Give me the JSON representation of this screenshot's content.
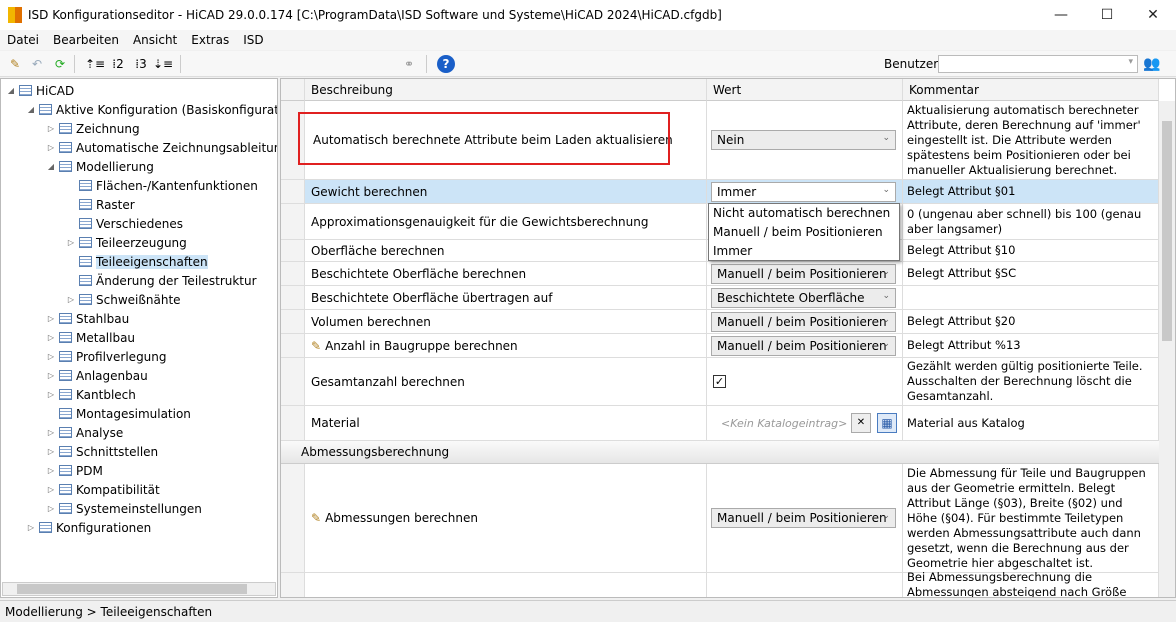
{
  "window": {
    "title": "ISD Konfigurationseditor  - HiCAD 29.0.0.174 [C:\\ProgramData\\ISD Software und Systeme\\HiCAD 2024\\HiCAD.cfgdb]",
    "minimize": "—",
    "maximize": "☐",
    "close": "✕"
  },
  "menu": [
    "Datei",
    "Bearbeiten",
    "Ansicht",
    "Extras",
    "ISD"
  ],
  "toolbar": {
    "icons": [
      "pencil-icon",
      "undo-icon",
      "refresh-icon",
      "expand-level1-icon",
      "level2-icon",
      "level3-icon",
      "collapse-icon",
      "binoculars-icon",
      "help-icon"
    ],
    "user_label": "Benutzer",
    "user_value": ""
  },
  "tree": [
    {
      "label": "HiCAD",
      "level": 0,
      "arrow": "◢"
    },
    {
      "label": "Aktive Konfiguration (Basiskonfiguration)",
      "level": 1,
      "arrow": "◢"
    },
    {
      "label": "Zeichnung",
      "level": 2,
      "arrow": "▷"
    },
    {
      "label": "Automatische Zeichnungsableitung",
      "level": 2,
      "arrow": "▷"
    },
    {
      "label": "Modellierung",
      "level": 2,
      "arrow": "◢"
    },
    {
      "label": "Flächen-/Kantenfunktionen",
      "level": 3,
      "arrow": ""
    },
    {
      "label": "Raster",
      "level": 3,
      "arrow": ""
    },
    {
      "label": "Verschiedenes",
      "level": 3,
      "arrow": ""
    },
    {
      "label": "Teileerzeugung",
      "level": 3,
      "arrow": "▷"
    },
    {
      "label": "Teileeigenschaften",
      "level": 3,
      "arrow": "",
      "selected": true
    },
    {
      "label": "Änderung der Teilestruktur",
      "level": 3,
      "arrow": ""
    },
    {
      "label": "Schweißnähte",
      "level": 3,
      "arrow": "▷"
    },
    {
      "label": "Stahlbau",
      "level": 2,
      "arrow": "▷"
    },
    {
      "label": "Metallbau",
      "level": 2,
      "arrow": "▷"
    },
    {
      "label": "Profilverlegung",
      "level": 2,
      "arrow": "▷"
    },
    {
      "label": "Anlagenbau",
      "level": 2,
      "arrow": "▷"
    },
    {
      "label": "Kantblech",
      "level": 2,
      "arrow": "▷"
    },
    {
      "label": "Montagesimulation",
      "level": 2,
      "arrow": ""
    },
    {
      "label": "Analyse",
      "level": 2,
      "arrow": "▷"
    },
    {
      "label": "Schnittstellen",
      "level": 2,
      "arrow": "▷"
    },
    {
      "label": "PDM",
      "level": 2,
      "arrow": "▷"
    },
    {
      "label": "Kompatibilität",
      "level": 2,
      "arrow": "▷"
    },
    {
      "label": "Systemeinstellungen",
      "level": 2,
      "arrow": "▷"
    },
    {
      "label": "Konfigurationen",
      "level": 1,
      "arrow": "▷"
    }
  ],
  "grid": {
    "headers": [
      "Beschreibung",
      "Wert",
      "Kommentar"
    ],
    "rows": [
      {
        "desc": "Automatisch berechnete Attribute beim Laden aktualisieren",
        "type": "combo",
        "value": "Nein",
        "comment": "Aktualisierung automatisch berechneter Attribute, deren Berechnung auf 'immer' eingestellt ist. Die Attribute werden spätestens beim Positionieren oder bei manueller Aktualisierung berechnet.",
        "h": 79,
        "highlighted": true
      },
      {
        "desc": "Gewicht berechnen",
        "type": "combo",
        "value": "Immer",
        "comment": "Belegt Attribut §01",
        "h": 24,
        "selected": true
      },
      {
        "desc": "Approximationsgenauigkeit für die Gewichtsberechnung",
        "type": "text",
        "value": "",
        "comment": "0 (ungenau aber schnell) bis 100 (genau aber langsamer)",
        "h": 36
      },
      {
        "desc": "Oberfläche berechnen",
        "type": "text",
        "value": "",
        "comment": "Belegt Attribut §10",
        "h": 22
      },
      {
        "desc": "Beschichtete Oberfläche berechnen",
        "type": "combo",
        "value": "Manuell / beim Positionieren",
        "comment": "Belegt Attribut §SC",
        "h": 24
      },
      {
        "desc": "Beschichtete Oberfläche übertragen auf",
        "type": "combo",
        "value": "Beschichtete Oberfläche",
        "comment": "",
        "h": 24
      },
      {
        "desc": "Volumen berechnen",
        "type": "combo",
        "value": "Manuell / beim Positionieren",
        "comment": "Belegt Attribut §20",
        "h": 24
      },
      {
        "desc": "Anzahl in Baugruppe berechnen",
        "type": "combo",
        "value": "Manuell / beim Positionieren",
        "comment": "Belegt Attribut %13",
        "h": 24,
        "pencil": true
      },
      {
        "desc": "Gesamtanzahl berechnen",
        "type": "check",
        "checked": true,
        "comment": "Gezählt werden gültig positionierte Teile. Ausschalten der Berechnung löscht die Gesamtanzahl.",
        "h": 48
      },
      {
        "desc": "Material",
        "type": "catalog",
        "value": "<Kein Katalogeintrag>",
        "comment": "Material aus Katalog",
        "h": 35
      }
    ],
    "section": "Abmessungsberechnung",
    "rows2": [
      {
        "desc": "Abmessungen berechnen",
        "type": "combo",
        "value": "Manuell / beim Positionieren",
        "comment": "Die Abmessung für Teile und Baugruppen aus der Geometrie ermitteln. Belegt Attribut Länge (§03), Breite (§02) und Höhe (§04). Für bestimmte Teiletypen werden Abmessungsattribute auch dann gesetzt, wenn die Berechnung aus der Geometrie hier abgeschaltet ist.",
        "h": 109,
        "pencil": true
      },
      {
        "desc": "",
        "type": "check",
        "checked": false,
        "comment": "Bei Abmessungsberechnung die Abmessungen absteigend nach Größe sortiert",
        "h": 40
      }
    ],
    "dropdown_options": [
      "Nicht automatisch berechnen",
      "Manuell / beim Positionieren",
      "Immer"
    ]
  },
  "status": "Modellierung > Teileeigenschaften",
  "colors": {
    "selection": "#cce4f7",
    "highlight_box": "#e02020",
    "accent": "#0a64c8"
  }
}
